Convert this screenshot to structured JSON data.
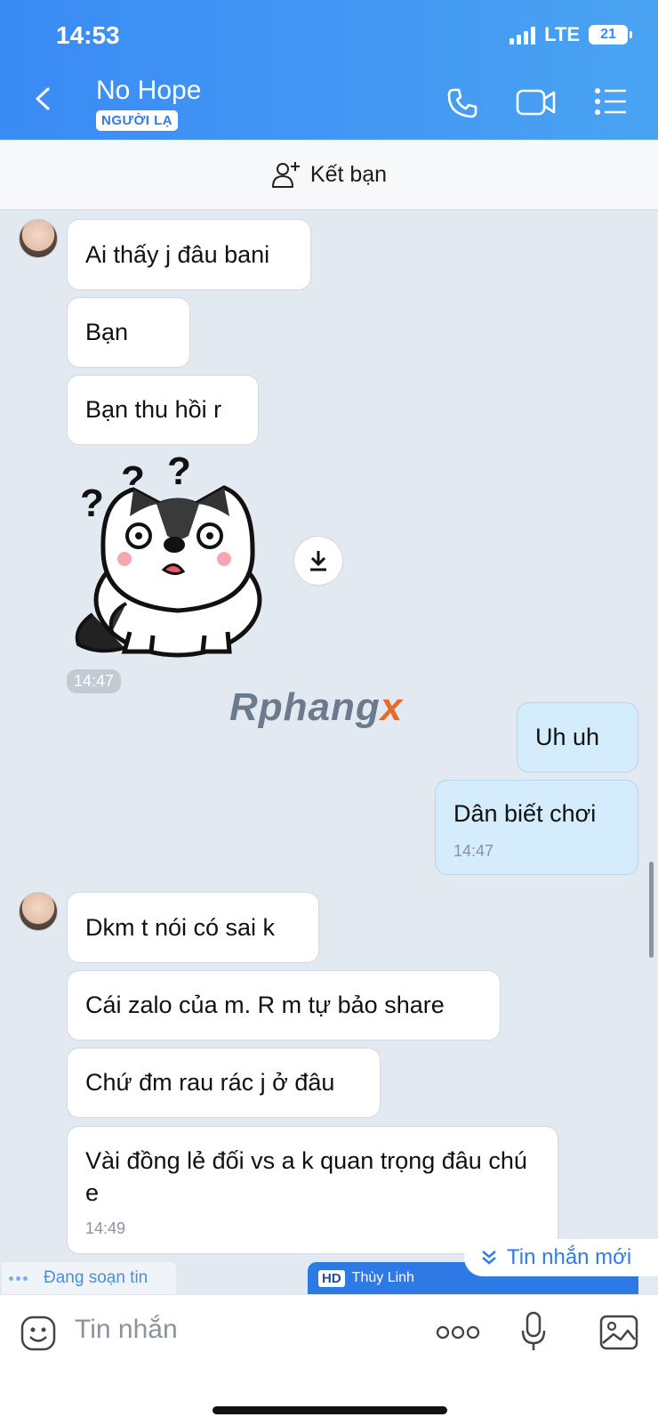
{
  "status": {
    "time": "14:53",
    "network": "LTE",
    "battery": "21"
  },
  "header": {
    "title": "No Hope",
    "badge": "NGƯỜI LẠ"
  },
  "add_friend": {
    "label": "Kết bạn"
  },
  "messages": {
    "m1": "Ai thấy j đâu bani",
    "m2": "Bạn",
    "m3": "Bạn thu hồi r",
    "sticker_time": "14:47",
    "m4": "Uh uh",
    "m5": "Dân biết chơi",
    "m5_time": "14:47",
    "m6": "Dkm t nói có sai k",
    "m7": "Cái zalo của m. R m tự bảo share",
    "m8": "Chứ đm rau rác j ở đâu",
    "m9": "Vài đồng lẻ đối vs a k quan trọng đâu chú e",
    "m9_time": "14:49"
  },
  "watermark": {
    "main": "Rphang",
    "suffix": "x"
  },
  "typing": {
    "label": "Đang soạn tin"
  },
  "new_messages": {
    "label": "Tin nhắn mới"
  },
  "pip": {
    "hd": "HD",
    "name": "Thùy Linh"
  },
  "composer": {
    "placeholder": "Tin nhắn"
  },
  "colors": {
    "header": "#3a8bf5",
    "my_bubble": "#d4ecfb",
    "background": "#e2e9f1"
  },
  "icons": [
    "back-icon",
    "phone-icon",
    "video-icon",
    "menu-icon",
    "add-person-icon",
    "download-icon",
    "chevron-down-icon",
    "emoji-icon",
    "more-icon",
    "mic-icon",
    "image-icon"
  ]
}
